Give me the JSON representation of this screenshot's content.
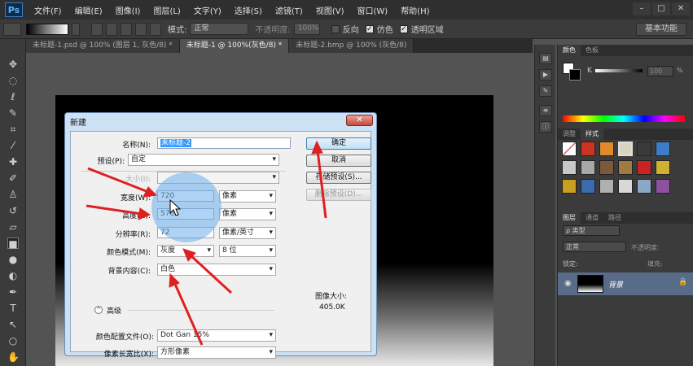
{
  "app": {
    "logo": "Ps"
  },
  "menu": [
    "文件(F)",
    "编辑(E)",
    "图像(I)",
    "图层(L)",
    "文字(Y)",
    "选择(S)",
    "滤镜(T)",
    "视图(V)",
    "窗口(W)",
    "帮助(H)"
  ],
  "window_controls": {
    "minimize": "–",
    "restore": "□",
    "close": "✕"
  },
  "options": {
    "mode_label": "模式:",
    "mode_value": "正常",
    "opacity_label": "不透明度:",
    "opacity_value": "100%",
    "reverse_label": "反向",
    "dither_label": "仿色",
    "transparency_label": "透明区域",
    "workspace": "基本功能"
  },
  "tabs": [
    "未标题-1.psd @ 100% (图层 1, 灰色/8) *",
    "未标题-1 @ 100%(灰色/8) *",
    "未标题-2.bmp @ 100% (灰色/8)"
  ],
  "panels": {
    "color_tabs": [
      "颜色",
      "色板"
    ],
    "color_k_label": "K",
    "color_k_value": "100",
    "style_tabs": [
      "调整",
      "样式"
    ],
    "layer_tabs": [
      "图层",
      "通道",
      "路径"
    ],
    "kind_label": "ρ 类型",
    "blend_mode": "正常",
    "opacity_label": "不透明度:",
    "lock_label": "锁定:",
    "fill_label": "填充:",
    "layer_name": "背景",
    "style_colors": [
      "#cc3322",
      "#e08a2a",
      "#5a4a3a",
      "#d8d4c0",
      "#3a3a3a",
      "#3c7cc8",
      "#c8c8c8",
      "#a8a8a8",
      "#7a5a3a",
      "#a07a40",
      "#cc2222",
      "#d0b030",
      "#c8a020",
      "#3a6ab0",
      "#b0b0b0",
      "#d8d8d8",
      "#8aa8c8",
      "#9050a0",
      "#555555",
      "#666666"
    ]
  },
  "dialog": {
    "title": "新建",
    "close": "✕",
    "name_label": "名称(N):",
    "name_value": "未标题-2",
    "preset_label": "预设(P):",
    "preset_value": "自定",
    "size_label": "大小(I):",
    "width_label": "宽度(W):",
    "width_value": "720",
    "width_unit": "像素",
    "height_label": "高度(H):",
    "height_value": "576",
    "height_unit": "像素",
    "resolution_label": "分辨率(R):",
    "resolution_value": "72",
    "resolution_unit": "像素/英寸",
    "color_mode_label": "颜色模式(M):",
    "color_mode_value": "灰度",
    "bit_depth": "8 位",
    "bg_label": "背景内容(C):",
    "bg_value": "白色",
    "advanced_label": "高级",
    "profile_label": "颜色配置文件(O):",
    "profile_value": "Dot Gan 15%",
    "aspect_label": "像素长宽比(X):",
    "aspect_value": "方形像素",
    "ok_button": "确定",
    "cancel_button": "取消",
    "save_preset_button": "存储预设(S)...",
    "delete_preset_button": "删除预设(D)...",
    "image_size_label": "图像大小:",
    "image_size_value": "405.0K"
  }
}
